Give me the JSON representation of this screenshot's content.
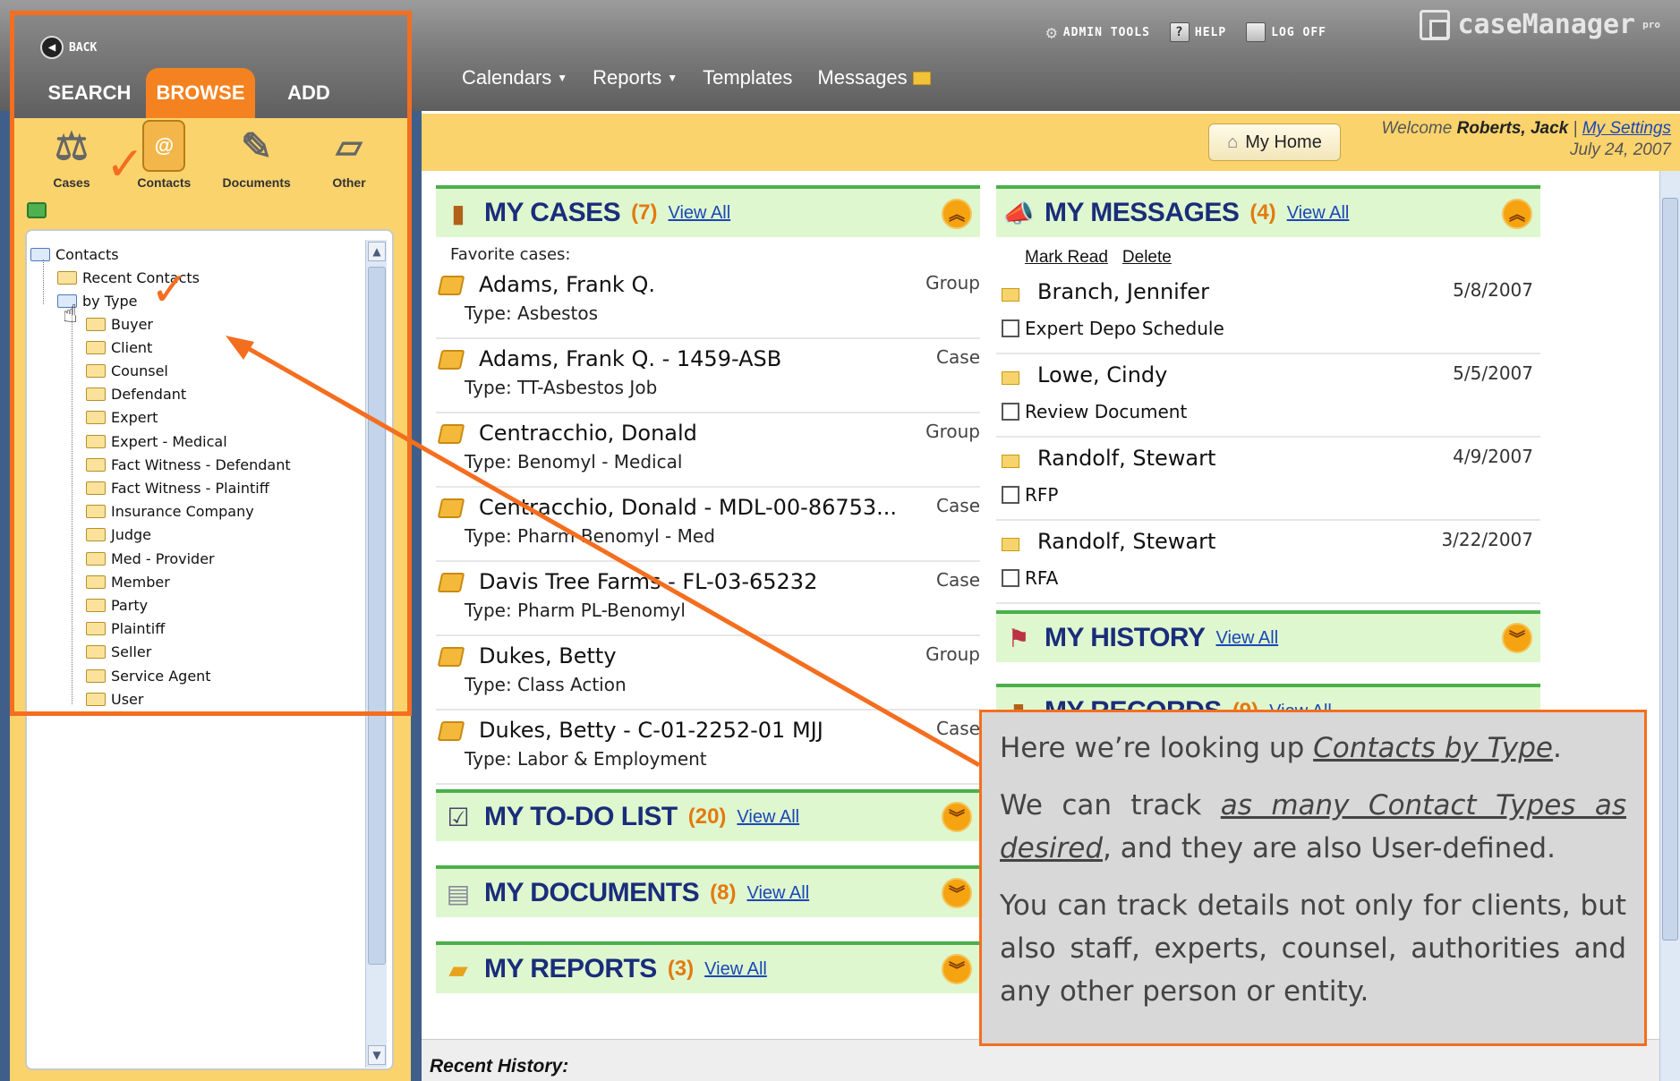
{
  "header": {
    "utility": [
      {
        "label": "ADMIN TOOLS",
        "icon": "gear-icon"
      },
      {
        "label": "HELP",
        "icon": "help-icon"
      },
      {
        "label": "LOG OFF",
        "icon": "logoff-icon"
      }
    ],
    "brand": "caseManager",
    "brand_sup": "pro",
    "nav": [
      {
        "label": "Calendars",
        "dropdown": true
      },
      {
        "label": "Reports",
        "dropdown": true
      },
      {
        "label": "Templates",
        "dropdown": false
      },
      {
        "label": "Messages",
        "icon": "envelope-icon"
      }
    ]
  },
  "left_panel": {
    "back_label": "BACK",
    "tabs": [
      "SEARCH",
      "BROWSE",
      "ADD"
    ],
    "active_tab": "BROWSE",
    "categories": [
      {
        "label": "Cases",
        "icon": "scales-icon"
      },
      {
        "label": "Contacts",
        "icon": "contacts-icon"
      },
      {
        "label": "Documents",
        "icon": "document-icon"
      },
      {
        "label": "Other",
        "icon": "box-icon"
      }
    ],
    "tree": {
      "root": "Contacts",
      "recent": "Recent Contacts",
      "by_type": "by Type",
      "types": [
        "Buyer",
        "Client",
        "Counsel",
        "Defendant",
        "Expert",
        "Expert - Medical",
        "Fact Witness - Defendant",
        "Fact Witness - Plaintiff",
        "Insurance Company",
        "Judge",
        "Med - Provider",
        "Member",
        "Party",
        "Plaintiff",
        "Seller",
        "Service Agent",
        "User"
      ]
    }
  },
  "welcome": {
    "home_button": "My Home",
    "prefix": "Welcome",
    "user": "Roberts, Jack",
    "separator": "|",
    "settings_link": "My Settings",
    "date": "July 24, 2007"
  },
  "sections": {
    "cases": {
      "title": "MY CASES",
      "count": "(7)",
      "view_all": "View All",
      "favorites_label": "Favorite cases:"
    },
    "messages": {
      "title": "MY MESSAGES",
      "count": "(4)",
      "view_all": "View All",
      "mark_read": "Mark Read",
      "delete": "Delete"
    },
    "history": {
      "title": "MY HISTORY",
      "view_all": "View All"
    },
    "records": {
      "title": "MY RECORDS",
      "count": "(9)",
      "view_all": "View All"
    },
    "todo": {
      "title": "MY TO-DO LIST",
      "count": "(20)",
      "view_all": "View All"
    },
    "documents": {
      "title": "MY DOCUMENTS",
      "count": "(8)",
      "view_all": "View All"
    },
    "reports": {
      "title": "MY REPORTS",
      "count": "(3)",
      "view_all": "View All"
    }
  },
  "cases": [
    {
      "name": "Adams, Frank Q.",
      "type": "Type: Asbestos",
      "kind": "Group"
    },
    {
      "name": "Adams, Frank Q. - 1459-ASB",
      "type": "Type: TT-Asbestos Job",
      "kind": "Case"
    },
    {
      "name": "Centracchio, Donald",
      "type": "Type: Benomyl - Medical",
      "kind": "Group"
    },
    {
      "name": "Centracchio, Donald - MDL-00-86753...",
      "type": "Type: Pharm-Benomyl - Med",
      "kind": "Case"
    },
    {
      "name": "Davis Tree Farms - FL-03-65232",
      "type": "Type: Pharm PL-Benomyl",
      "kind": "Case"
    },
    {
      "name": "Dukes, Betty",
      "type": "Type: Class Action",
      "kind": "Group"
    },
    {
      "name": "Dukes, Betty - C-01-2252-01 MJJ",
      "type": "Type: Labor & Employment",
      "kind": "Case"
    }
  ],
  "messages": [
    {
      "from": "Branch, Jennifer",
      "date": "5/8/2007",
      "subject": "Expert Depo Schedule"
    },
    {
      "from": "Lowe, Cindy",
      "date": "5/5/2007",
      "subject": "Review Document"
    },
    {
      "from": "Randolf, Stewart",
      "date": "4/9/2007",
      "subject": "RFP"
    },
    {
      "from": "Randolf, Stewart",
      "date": "3/22/2007",
      "subject": "RFA"
    }
  ],
  "recent_history_label": "Recent History:",
  "callout": {
    "p1_pre": "Here we’re looking up ",
    "p1_em": "Contacts by Type",
    "p1_post": ".",
    "p2_pre": "We can track ",
    "p2_em": "as many Contact Types as desired",
    "p2_post": ", and they are also User-defined.",
    "p3": "You can track details not only for clients, but also staff, experts, counsel, authorities and any other person or entity."
  },
  "colors": {
    "accent": "#f46e1f",
    "panel": "#fad36d",
    "section_bg": "#dff7cf",
    "section_title": "#1a2d7a"
  }
}
